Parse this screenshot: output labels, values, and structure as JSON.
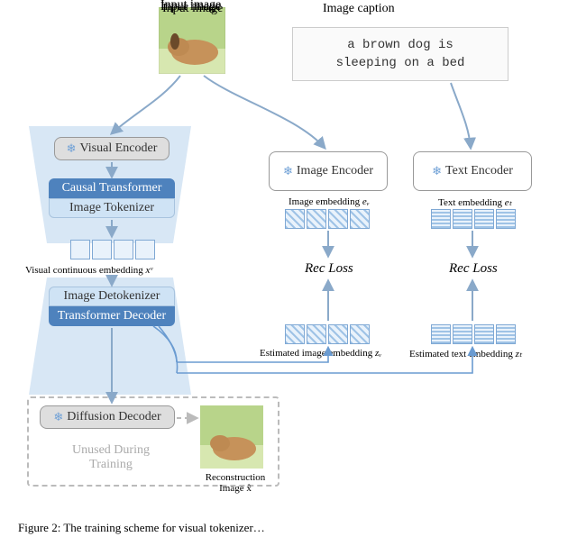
{
  "header": {
    "input_image_label": "Input image",
    "image_caption_label": "Image caption",
    "caption_text_line1": "a brown dog is",
    "caption_text_line2": "sleeping on a bed"
  },
  "left": {
    "visual_encoder": "Visual Encoder",
    "causal_transformer": "Causal Transformer",
    "image_tokenizer": "Image Tokenizer",
    "visual_embed_label": "Visual continuous embedding ",
    "visual_embed_sym": "xᵛ",
    "image_detokenizer": "Image Detokenizer",
    "transformer_decoder": "Transformer Decoder",
    "diffusion_decoder": "Diffusion Decoder",
    "unused_label_line1": "Unused During",
    "unused_label_line2": "Training",
    "recon_label": "Reconstruction",
    "recon_sym": "Image x̂"
  },
  "middle": {
    "image_encoder": "Image Encoder",
    "img_embed_label": "Image embedding ",
    "img_embed_sym": "eᵥ",
    "rec_loss": "Rec Loss",
    "est_img_label": "Estimated image embedding ",
    "est_img_sym": "zᵥ"
  },
  "right": {
    "text_encoder": "Text Encoder",
    "text_embed_label": "Text embedding ",
    "text_embed_sym": "eₜ",
    "rec_loss": "Rec Loss",
    "est_text_label": "Estimated text embedding ",
    "est_text_sym": "zₜ"
  },
  "figure_caption_prefix": "Figure 2:",
  "figure_caption_rest": " The training scheme for visual tokenizer…",
  "icons": {
    "snowflake": "❄"
  }
}
